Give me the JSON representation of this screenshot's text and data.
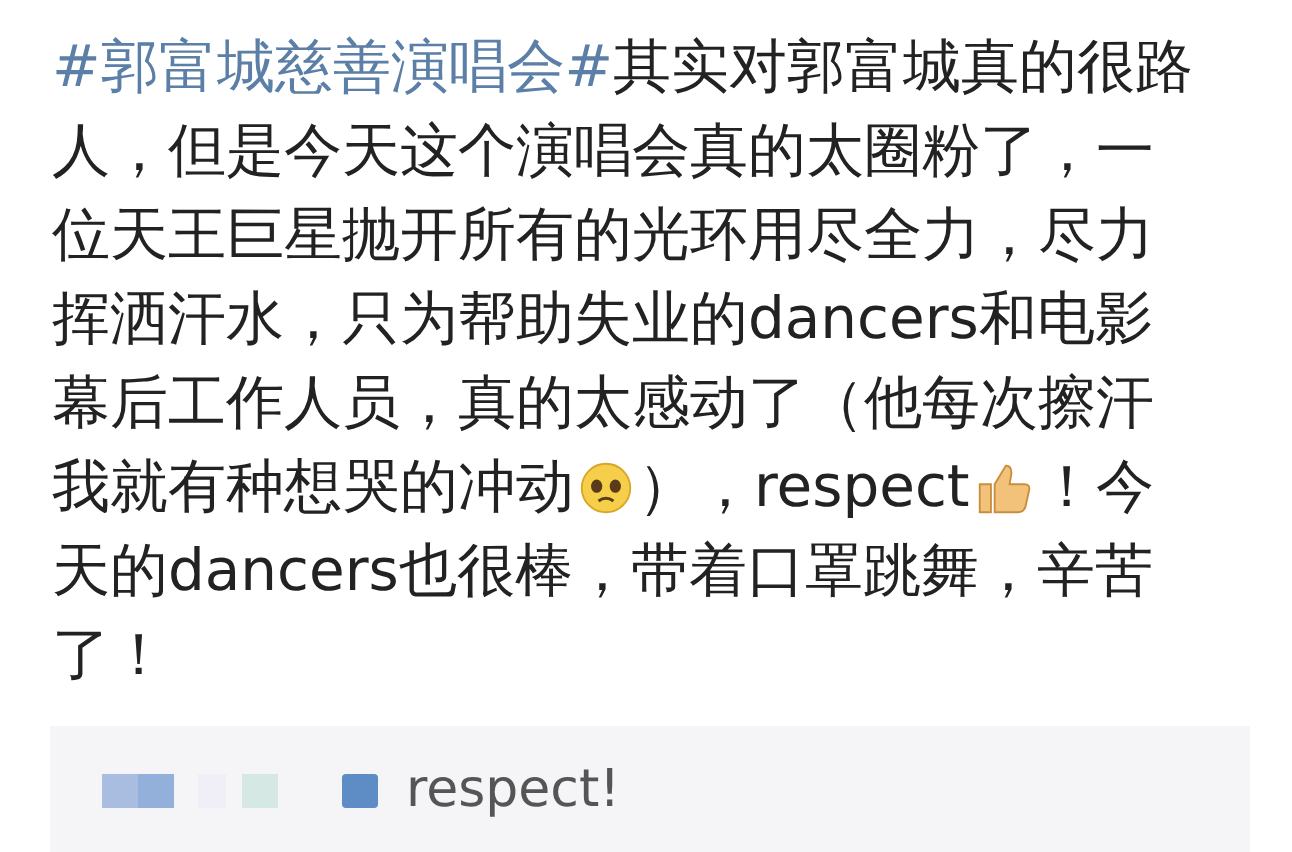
{
  "post": {
    "lines": [
      [
        {
          "kind": "hashtag",
          "text": "#郭富城慈善演唱会#"
        },
        {
          "kind": "text",
          "text": "其实对郭富城真的很路"
        }
      ],
      [
        {
          "kind": "text",
          "text": "人，但是今天这个演唱会真的太圈粉了，一"
        }
      ],
      [
        {
          "kind": "text",
          "text": "位天王巨星抛开所有的光环用尽全力，尽力"
        }
      ],
      [
        {
          "kind": "text",
          "text": "挥洒汗水，只为帮助失业的dancers和电影"
        }
      ],
      [
        {
          "kind": "text",
          "text": "幕后工作人员，真的太感动了（他每次擦汗"
        }
      ],
      [
        {
          "kind": "text",
          "text": "我就有种想哭的冲动"
        },
        {
          "kind": "sad-emoji"
        },
        {
          "kind": "text",
          "text": "），respect"
        },
        {
          "kind": "thumbs-emoji"
        },
        {
          "kind": "text",
          "text": "！今"
        }
      ],
      [
        {
          "kind": "text",
          "text": "天的dancers也很棒，带着口罩跳舞，辛苦"
        }
      ],
      [
        {
          "kind": "text",
          "text": "了！"
        }
      ]
    ]
  },
  "comment": {
    "text": "respect!"
  }
}
